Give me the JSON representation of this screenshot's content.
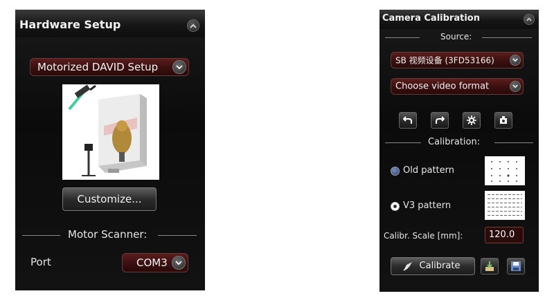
{
  "hardware_setup": {
    "title": "Hardware Setup",
    "setup_select": "Motorized DAVID Setup",
    "customize_label": "Customize...",
    "motor_scanner_heading": "Motor Scanner:",
    "port_label": "Port",
    "port_value": "COM3"
  },
  "camera_calibration": {
    "title": "Camera Calibration",
    "source_heading": "Source:",
    "source_select": "SB 视频设备 (3FD53166)",
    "format_select": "Choose video format",
    "calibration_heading": "Calibration:",
    "old_pattern_label": "Old pattern",
    "v3_pattern_label": "V3 pattern",
    "selected_pattern": "V3 pattern",
    "scale_label": "Calibr. Scale [mm]:",
    "scale_value": "120.0",
    "calibrate_label": "Calibrate"
  },
  "icons": [
    "collapse-icon",
    "chevron-down-icon",
    "rotate-left-icon",
    "rotate-right-icon",
    "settings-icon",
    "camera-icon",
    "calibrate-icon",
    "load-icon",
    "save-icon"
  ],
  "colors": {
    "panel_bg": "#111111",
    "dropdown_bg": "#4a1515",
    "accent_border": "#6a3a3a"
  }
}
